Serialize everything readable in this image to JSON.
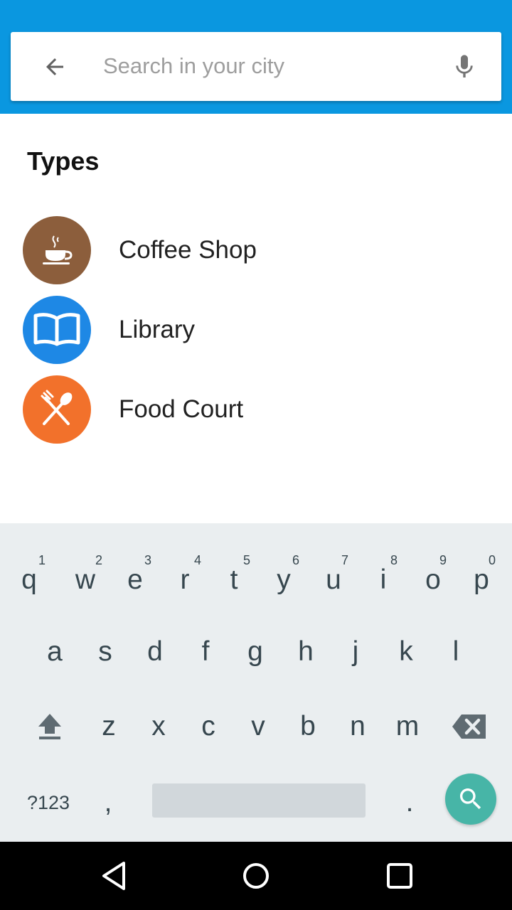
{
  "search": {
    "placeholder": "Search in your city",
    "value": ""
  },
  "icons": {
    "back": "arrow-back-icon",
    "mic": "microphone-icon"
  },
  "types": {
    "title": "Types",
    "items": [
      {
        "label": "Coffee Shop",
        "icon": "coffee-cup-icon",
        "color": "#8c5e3c"
      },
      {
        "label": "Library",
        "icon": "open-book-icon",
        "color": "#1e88e5"
      },
      {
        "label": "Food Court",
        "icon": "fork-spoon-icon",
        "color": "#f2712b"
      }
    ]
  },
  "keyboard": {
    "row1": [
      "q",
      "w",
      "e",
      "r",
      "t",
      "y",
      "u",
      "i",
      "o",
      "p"
    ],
    "row1_hints": [
      "1",
      "2",
      "3",
      "4",
      "5",
      "6",
      "7",
      "8",
      "9",
      "0"
    ],
    "row2": [
      "a",
      "s",
      "d",
      "f",
      "g",
      "h",
      "j",
      "k",
      "l"
    ],
    "row3": [
      "z",
      "x",
      "c",
      "v",
      "b",
      "n",
      "m"
    ],
    "symbols_label": "?123",
    "comma": ",",
    "period": ".",
    "shift_icon": "shift-icon",
    "backspace_icon": "backspace-icon",
    "search_icon": "search-icon",
    "accent": "#47b5a7"
  },
  "colors": {
    "appbar": "#0a97e0",
    "keyboard_bg": "#eaeef0"
  }
}
